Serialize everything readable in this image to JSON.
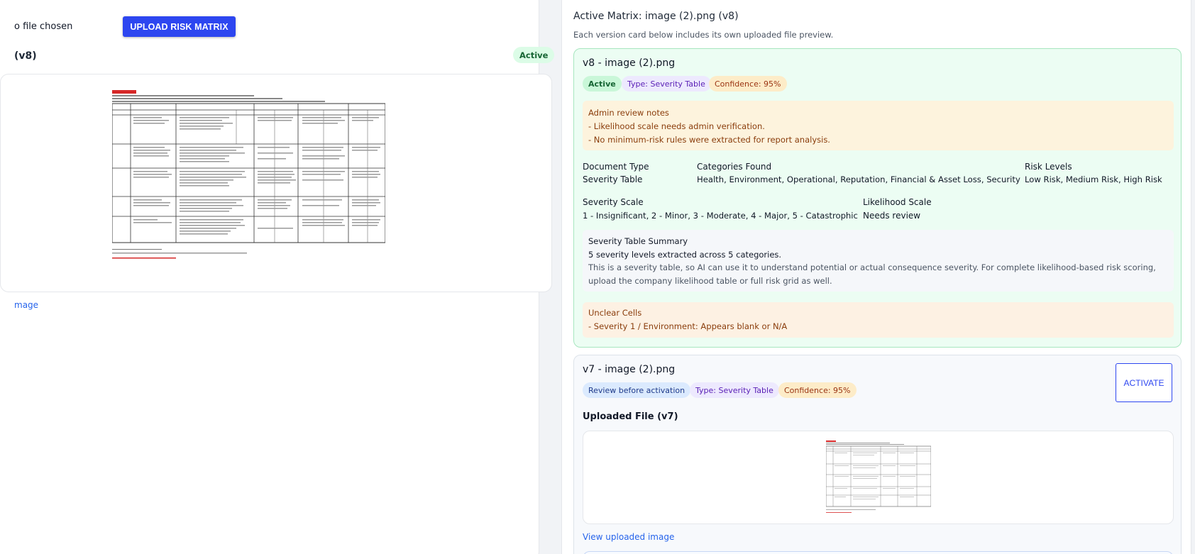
{
  "upload": {
    "file_status": "o file chosen",
    "button_label": "UPLOAD RISK MATRIX"
  },
  "left": {
    "version_label": "(v8)",
    "status_badge": "Active",
    "view_link": "mage"
  },
  "right": {
    "title": "Active Matrix: image (2).png (v8)",
    "subtitle": "Each version card below includes its own uploaded file preview."
  },
  "v8": {
    "title": "v8 - image (2).png",
    "badges": {
      "status": "Active",
      "type": "Type: Severity Table",
      "confidence": "Confidence: 95%"
    },
    "admin_notes": {
      "title": "Admin review notes",
      "lines": [
        "- Likelihood scale needs admin verification.",
        "- No minimum-risk rules were extracted for report analysis."
      ]
    },
    "fields": {
      "document_type_label": "Document Type",
      "document_type_value": "Severity Table",
      "categories_label": "Categories Found",
      "categories_value": "Health, Environment, Operational, Reputation, Financial & Asset Loss, Security",
      "risk_levels_label": "Risk Levels",
      "risk_levels_value": "Low Risk, Medium Risk, High Risk",
      "severity_scale_label": "Severity Scale",
      "severity_scale_value": "1 - Insignificant, 2 - Minor, 3 - Moderate, 4 - Major, 5 - Catastrophic",
      "likelihood_scale_label": "Likelihood Scale",
      "likelihood_scale_value": "Needs review"
    },
    "summary": {
      "title": "Severity Table Summary",
      "headline": "5 severity levels extracted across 5 categories.",
      "description_line1": "This is a severity table, so AI can use it to understand potential or actual consequence severity. For complete likelihood-based risk scoring,",
      "description_line2": "upload the company likelihood table or full risk grid as well."
    },
    "unclear": {
      "title": "Unclear Cells",
      "line": "- Severity 1 / Environment: Appears blank or N/A"
    }
  },
  "v7": {
    "title": "v7 - image (2).png",
    "badges": {
      "status": "Review before activation",
      "type": "Type: Severity Table",
      "confidence": "Confidence: 95%"
    },
    "activate_label": "ACTIVATE",
    "uploaded_file_title": "Uploaded File (v7)",
    "view_link": "View uploaded image"
  },
  "colors": {
    "primary_button": "#2d46f0",
    "active_card_bg": "#ecfdf3",
    "link": "#2563eb"
  }
}
